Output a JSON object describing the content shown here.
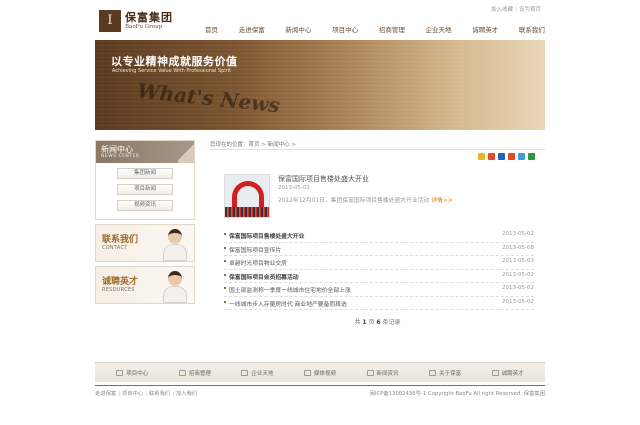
{
  "header": {
    "logo_mark": "I",
    "logo_cn": "保富集团",
    "logo_en": "BaoFu Group",
    "toplinks": [
      "加入收藏",
      "设为首页"
    ],
    "nav": [
      "首页",
      "走进保富",
      "新闻中心",
      "项目中心",
      "招商管理",
      "企业天地",
      "诚聘英才",
      "联系我们"
    ]
  },
  "banner": {
    "slogan_cn": "以专业精神成就服务价值",
    "slogan_en": "Achieving Service Value With Professional Spirit",
    "paper_text": "What's News"
  },
  "sidebar": {
    "news_cn": "新闻中心",
    "news_en": "NEWS CENTER",
    "news_items": [
      "集团新闻",
      "项目新闻",
      "视频资讯"
    ],
    "contact_cn": "联系我们",
    "contact_en": "CONTACT",
    "jobs_cn": "诚聘英才",
    "jobs_en": "RESOURCES"
  },
  "breadcrumb": {
    "prefix": "您现在的位置：",
    "home": "首页",
    "sep": " > ",
    "current": "新闻中心 >"
  },
  "share_icons": [
    {
      "name": "qzone-icon",
      "color": "#f1b424"
    },
    {
      "name": "sina-weibo-icon",
      "color": "#e34a2d"
    },
    {
      "name": "renren-icon",
      "color": "#1f64c4"
    },
    {
      "name": "kaixin-icon",
      "color": "#e44b20"
    },
    {
      "name": "tencent-weibo-icon",
      "color": "#3ba1d8"
    },
    {
      "name": "douban-icon",
      "color": "#2e963d"
    }
  ],
  "feature": {
    "title": "保富国际项目售楼处盛大开业",
    "date": "2013-05-02",
    "desc": "2012年12月01日，集团保富国际项目售楼处盛大开业活动",
    "more": "详情>>"
  },
  "news_list": [
    {
      "title": "保富国际项目售楼处盛大开业",
      "date": "2013-05-02",
      "bold": true
    },
    {
      "title": "保富国际项目宣传片",
      "date": "2013-05-08",
      "bold": false
    },
    {
      "title": "卓越时光项目物业交房",
      "date": "2013-05-03",
      "bold": false
    },
    {
      "title": "保富国际项目会员招募活动",
      "date": "2013-05-02",
      "bold": true
    },
    {
      "title": "国土部监测称一季度一线城市住宅地价全部上涨",
      "date": "2013-05-02",
      "bold": false
    },
    {
      "title": "一线城市步入存量房时代 商业地产要备而择选",
      "date": "2013-05-02",
      "bold": false
    }
  ],
  "pager": {
    "pre": "共 ",
    "pages": "1",
    "mid": " 页 ",
    "count": "6",
    "post": " 条记录"
  },
  "footer_nav": [
    {
      "label": "项目中心",
      "icon": "building-icon"
    },
    {
      "label": "招商管理",
      "icon": "handshake-icon"
    },
    {
      "label": "企业天地",
      "icon": "gear-icon"
    },
    {
      "label": "媒体视频",
      "icon": "video-icon"
    },
    {
      "label": "新闻资讯",
      "icon": "newspaper-icon"
    },
    {
      "label": "关于保富",
      "icon": "info-icon"
    },
    {
      "label": "诚聘英才",
      "icon": "person-icon"
    }
  ],
  "footer_links": [
    "走进保富",
    "项目中心",
    "联系我们",
    "加入我们"
  ],
  "copyright": "闽ICP备13002436号-1 Copyright BaoFu All right Reserved. 保富集团"
}
